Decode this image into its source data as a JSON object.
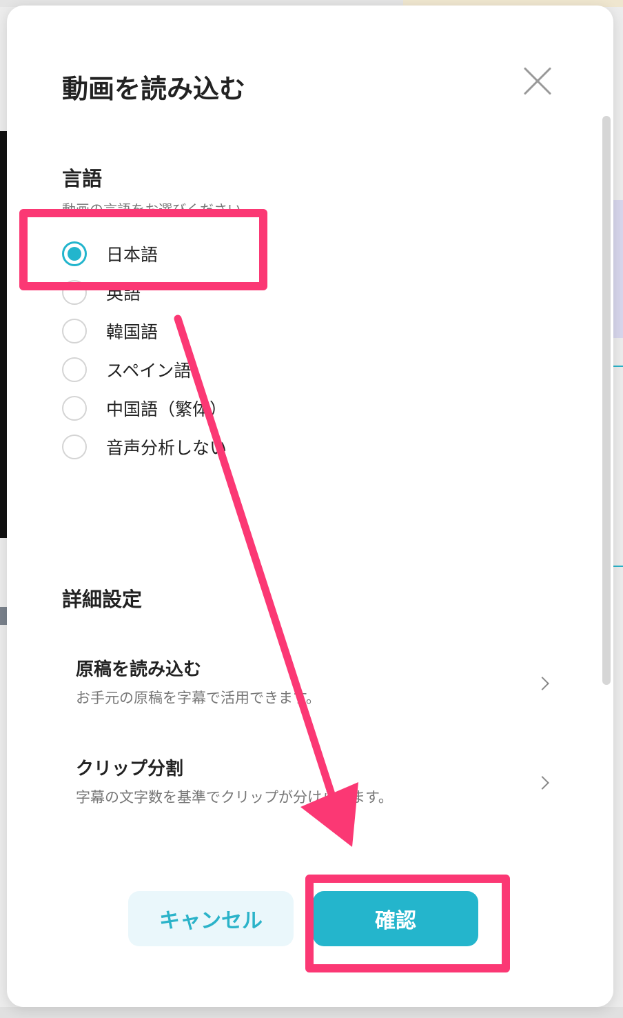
{
  "dialog": {
    "title": "動画を読み込む",
    "close_icon": "close-icon"
  },
  "language_section": {
    "title": "言語",
    "description": "動画の言語をお選びください。",
    "options": [
      {
        "label": "日本語",
        "selected": true
      },
      {
        "label": "英語",
        "selected": false
      },
      {
        "label": "韓国語",
        "selected": false
      },
      {
        "label": "スペイン語",
        "selected": false
      },
      {
        "label": "中国語（繁体）",
        "selected": false
      },
      {
        "label": "音声分析しない",
        "selected": false
      }
    ]
  },
  "advanced_section": {
    "title": "詳細設定",
    "items": [
      {
        "title": "原稿を読み込む",
        "description": "お手元の原稿を字幕で活用できます。",
        "icon": "chevron-right-icon"
      },
      {
        "title": "クリップ分割",
        "description": "字幕の文字数を基準でクリップが分けられます。",
        "icon": "chevron-right-icon"
      }
    ]
  },
  "buttons": {
    "cancel": "キャンセル",
    "confirm": "確認"
  },
  "colors": {
    "accent": "#24b5cc",
    "annotation": "#fb3874"
  }
}
